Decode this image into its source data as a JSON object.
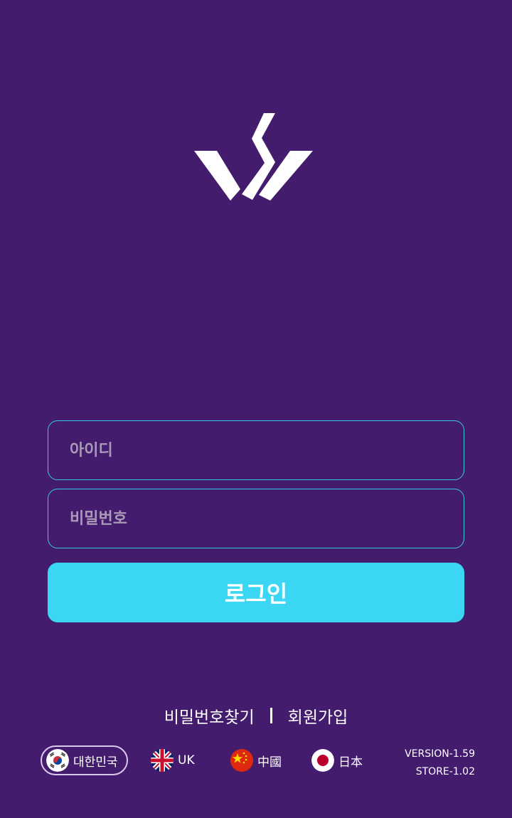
{
  "colors": {
    "background": "#441c6e",
    "accent": "#3cd6f5",
    "input_border": "#3cc6ea",
    "placeholder": "#a99ab8",
    "text": "#ffffff"
  },
  "logo": {
    "icon": "brand-logo-icon"
  },
  "form": {
    "id_placeholder": "아이디",
    "id_value": "",
    "password_placeholder": "비밀번호",
    "password_value": "",
    "login_label": "로그인"
  },
  "links": {
    "find_password": "비밀번호찾기",
    "signup": "회원가입"
  },
  "languages": [
    {
      "label": "대한민국",
      "icon": "korea-flag-icon",
      "selected": true
    },
    {
      "label": "UK",
      "icon": "uk-flag-icon",
      "selected": false
    },
    {
      "label": "中國",
      "icon": "china-flag-icon",
      "selected": false
    },
    {
      "label": "日本",
      "icon": "japan-flag-icon",
      "selected": false
    }
  ],
  "version": {
    "app": "VERSION-1.59",
    "store": "STORE-1.02"
  }
}
